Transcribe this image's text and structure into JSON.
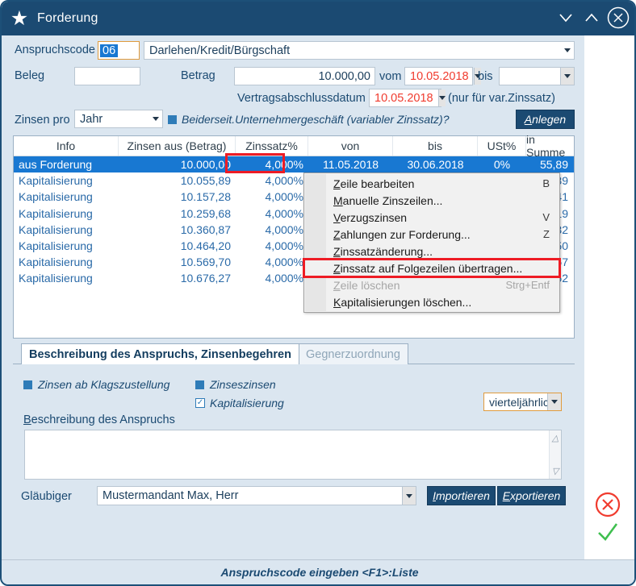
{
  "window": {
    "title": "Forderung",
    "icon": "star-icon",
    "controls": [
      "chevron-down-icon",
      "chevron-up-icon",
      "close-circle-icon"
    ],
    "accent_color": "#1b4a72",
    "background_color": "#dbe6f0"
  },
  "form": {
    "anspruchscode_label": "Anspruchscode",
    "anspruchscode_value": "06",
    "anspruchscode_text": "Darlehen/Kredit/Bürgschaft",
    "beleg_label": "Beleg",
    "beleg_value": "",
    "betrag_label": "Betrag",
    "betrag_value": "10.000,00",
    "vom_label": "vom",
    "vom_value": "10.05.2018",
    "bis_label": "bis",
    "bis_value": "",
    "vertragsabschlussdatum_label": "Vertragsabschlussdatum",
    "vertragsabschlussdatum_value": "10.05.2018",
    "var_zinssatz_hint": "(nur für var.Zinssatz)",
    "zinsen_pro_label": "Zinsen pro",
    "zinsen_pro_value": "Jahr",
    "unternehmergeschaeft_label": "Beiderseit.Unternehmergeschäft (variabler Zinssatz)?",
    "anlegen_label": "Anlegen",
    "date_color": "#f03b2e"
  },
  "grid": {
    "columns": [
      "Info",
      "Zinsen aus (Betrag)",
      "Zinssatz%",
      "von",
      "bis",
      "USt%",
      "in Summe"
    ],
    "selected_row_index": 0,
    "highlight_cell_color": "#ee1c25",
    "rows": [
      {
        "info": "aus Forderung",
        "betrag": "10.000,00",
        "zinssatz": "4,000%",
        "von": "11.05.2018",
        "bis": "30.06.2018",
        "ust": "0%",
        "summe": "55,89"
      },
      {
        "info": "Kapitalisierung",
        "betrag": "10.055,89",
        "zinssatz": "4,000%",
        "von": "",
        "bis": "",
        "ust": "",
        "summe": "89"
      },
      {
        "info": "Kapitalisierung",
        "betrag": "10.157,28",
        "zinssatz": "4,000%",
        "von": "",
        "bis": "",
        "ust": "",
        "summe": "41"
      },
      {
        "info": "Kapitalisierung",
        "betrag": "10.259,68",
        "zinssatz": "4,000%",
        "von": "",
        "bis": "",
        "ust": "",
        "summe": "19"
      },
      {
        "info": "Kapitalisierung",
        "betrag": "10.360,87",
        "zinssatz": "4,000%",
        "von": "",
        "bis": "",
        "ust": "",
        "summe": "32"
      },
      {
        "info": "Kapitalisierung",
        "betrag": "10.464,20",
        "zinssatz": "4,000%",
        "von": "",
        "bis": "",
        "ust": "",
        "summe": "50"
      },
      {
        "info": "Kapitalisierung",
        "betrag": "10.569,70",
        "zinssatz": "4,000%",
        "von": "",
        "bis": "",
        "ust": "",
        "summe": "57"
      },
      {
        "info": "Kapitalisierung",
        "betrag": "10.676,27",
        "zinssatz": "4,000%",
        "von": "",
        "bis": "",
        "ust": "",
        "summe": "52"
      }
    ]
  },
  "context_menu": {
    "highlighted_index": 5,
    "items": [
      {
        "label": "Zeile bearbeiten",
        "accel": "B",
        "disabled": false
      },
      {
        "label": "Manuelle Zinszeilen...",
        "accel": "",
        "disabled": false
      },
      {
        "label": "Verzugszinsen",
        "accel": "V",
        "disabled": false
      },
      {
        "label": "Zahlungen zur Forderung...",
        "accel": "Z",
        "disabled": false
      },
      {
        "label": "Zinssatzänderung...",
        "accel": "",
        "disabled": false
      },
      {
        "label": "Zinssatz auf Folgezeilen übertragen...",
        "accel": "",
        "disabled": false
      },
      {
        "label": "Zeile löschen",
        "accel": "Strg+Entf",
        "disabled": true
      },
      {
        "label": "Kapitalisierungen löschen...",
        "accel": "",
        "disabled": false
      }
    ]
  },
  "tabs": [
    {
      "label": "Beschreibung des Anspruchs, Zinsenbegehren",
      "active": true
    },
    {
      "label": "Gegnerzuordnung",
      "active": false
    }
  ],
  "options": {
    "zinsen_ab_klagszustellung": "Zinsen ab Klagszustellung",
    "zinseszinsen": "Zinseszinsen",
    "kapitalisierung": "Kapitalisierung",
    "kapitalisierung_checked": true,
    "interval_value": "vierteljährlich",
    "beschreibung_label": "Beschreibung des Anspruchs",
    "beschreibung_value": ""
  },
  "footer": {
    "glaeubiger_label": "Gläubiger",
    "glaeubiger_value": "Mustermandant Max, Herr",
    "importieren_label": "Importieren",
    "exportieren_label": "Exportieren",
    "status_text": "Anspruchscode eingeben  <F1>:Liste",
    "cancel_icon": "cancel-circle-icon",
    "confirm_icon": "check-icon",
    "cancel_color": "#f03b2e",
    "confirm_color": "#3fbf4f"
  }
}
